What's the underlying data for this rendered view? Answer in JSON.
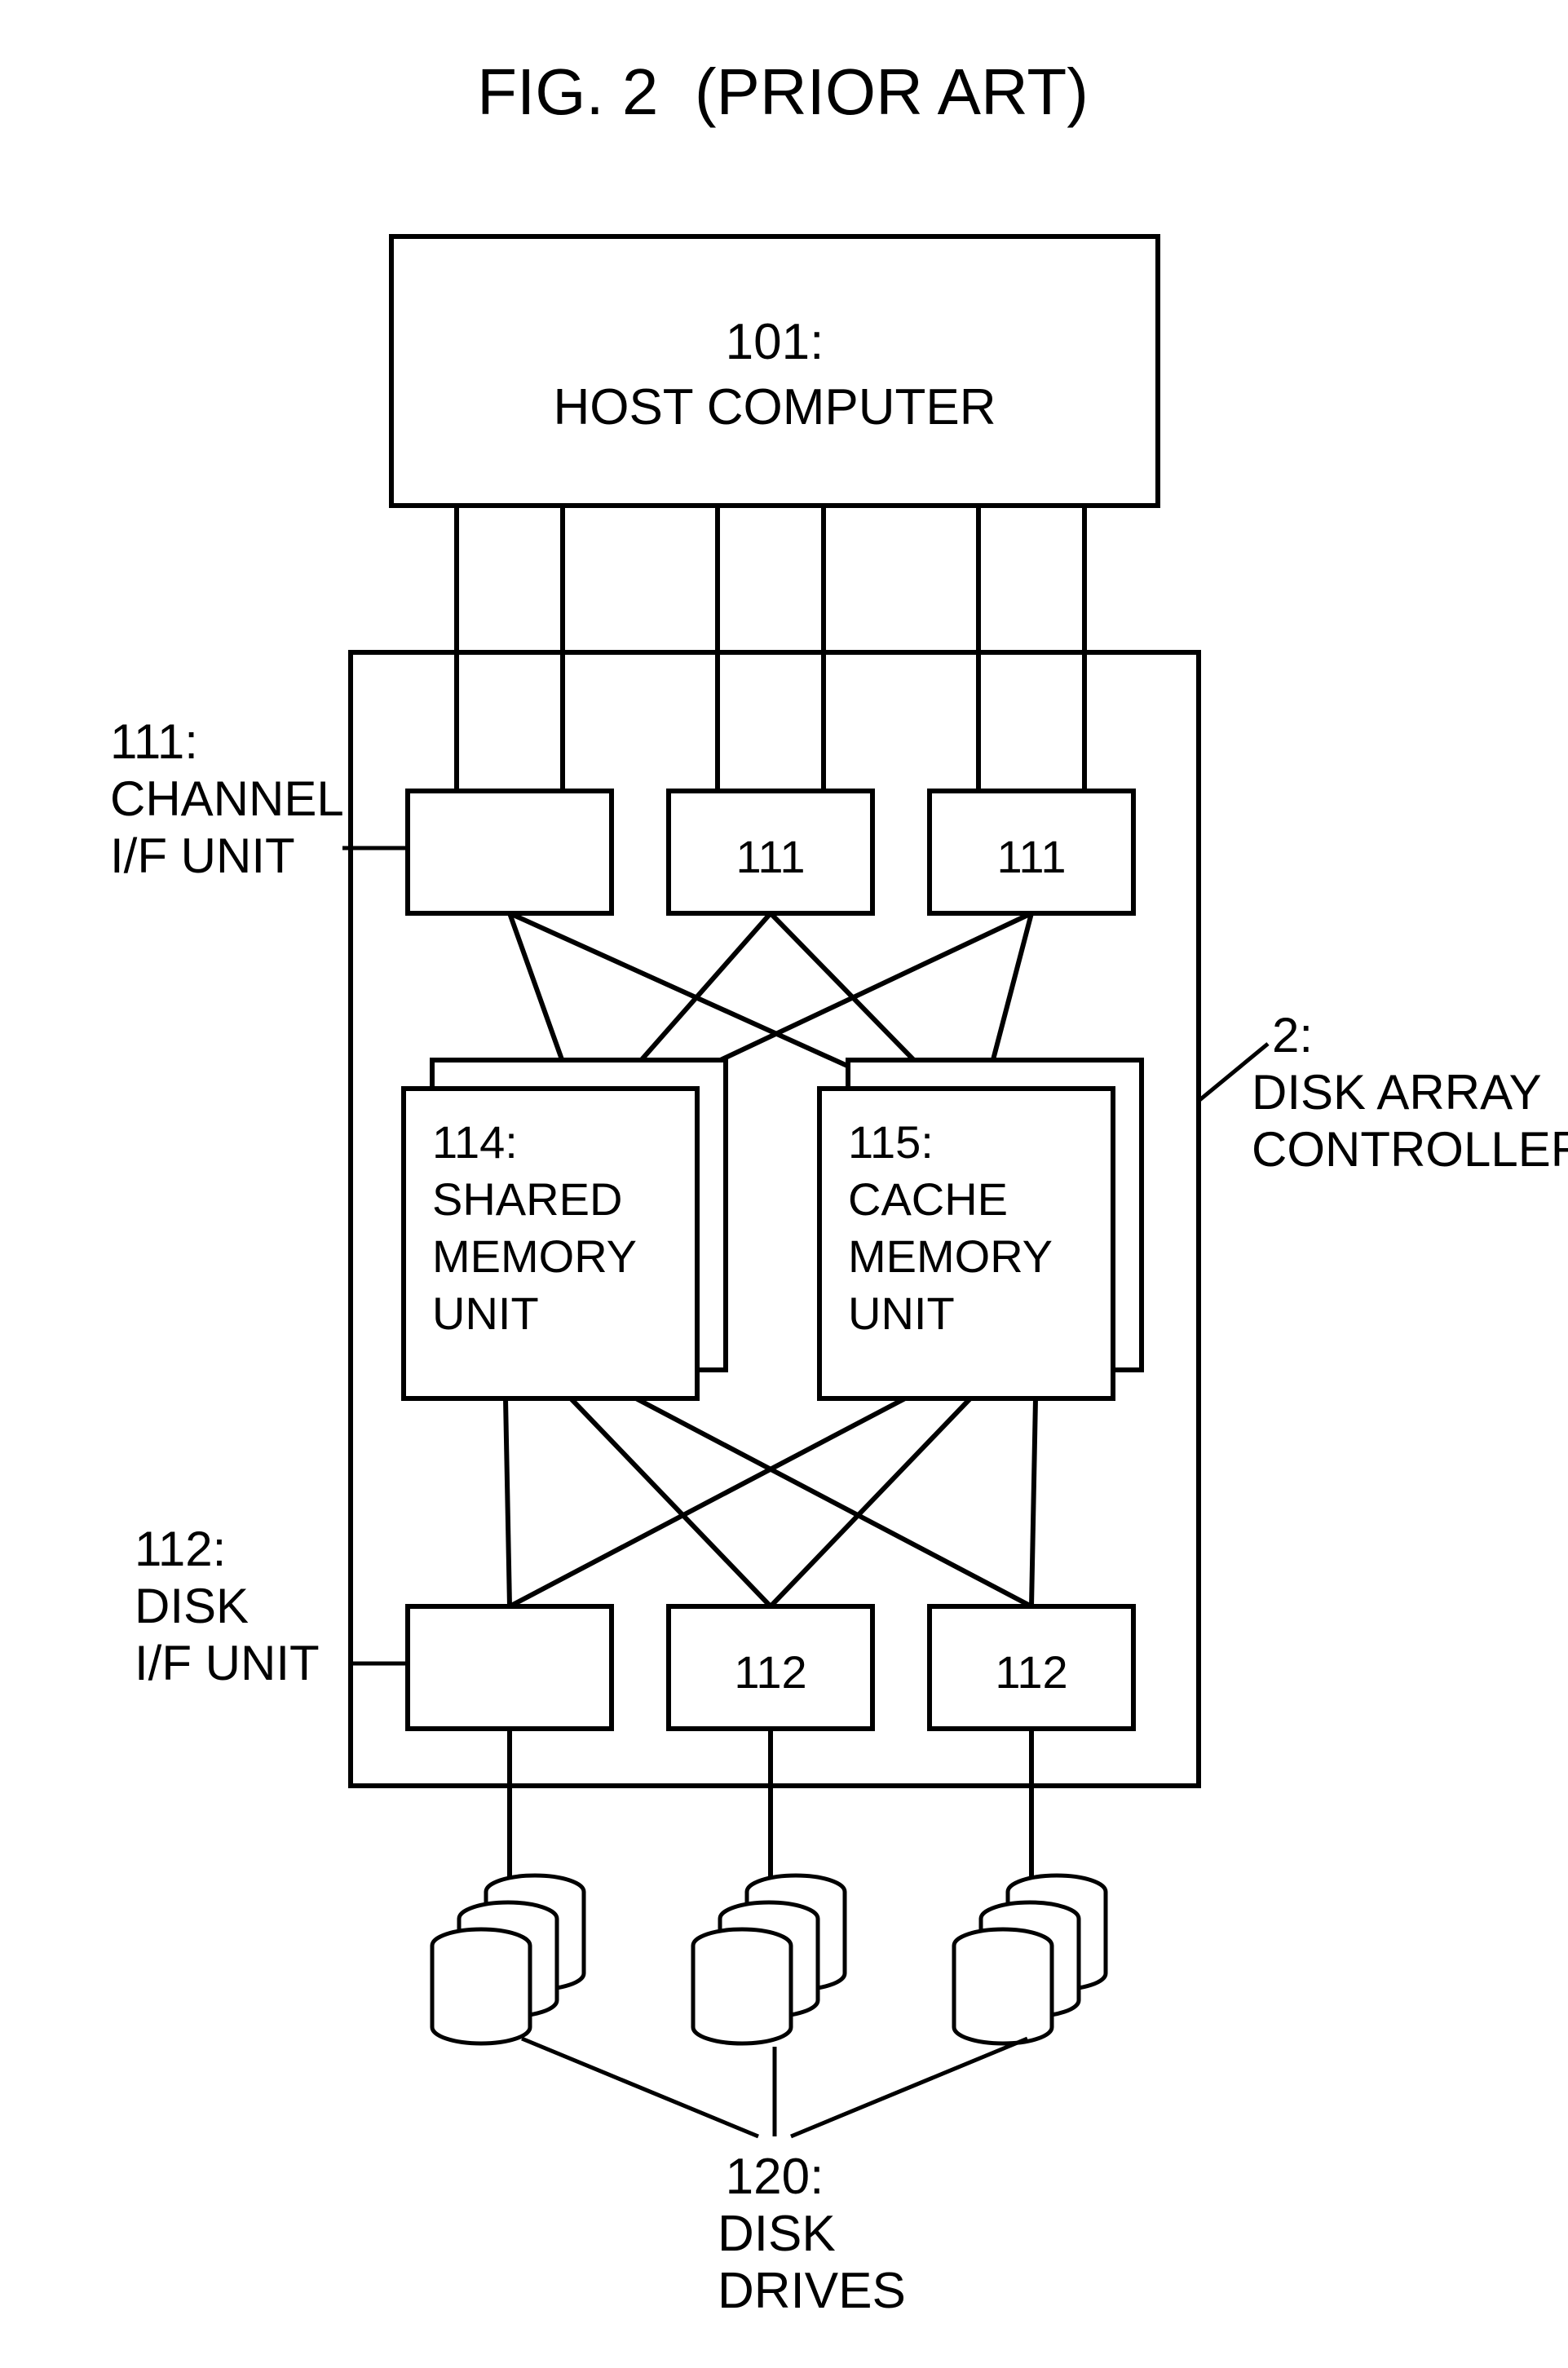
{
  "figure_title": "FIG. 2  (PRIOR ART)",
  "host": {
    "id": "101:",
    "name": "HOST COMPUTER"
  },
  "controller": {
    "id": "2:",
    "name_l1": "DISK ARRAY",
    "name_l2": "CONTROLLER"
  },
  "channel_if": {
    "id": "111:",
    "name_l1": "CHANNEL",
    "name_l2": "I/F UNIT",
    "box_label": "111"
  },
  "disk_if": {
    "id": "112:",
    "name_l1": "DISK",
    "name_l2": "I/F UNIT",
    "box_label": "112"
  },
  "shared_mem": {
    "id": "114:",
    "name_l1": "SHARED",
    "name_l2": "MEMORY",
    "name_l3": "UNIT"
  },
  "cache_mem": {
    "id": "115:",
    "name_l1": "CACHE",
    "name_l2": "MEMORY",
    "name_l3": "UNIT"
  },
  "drives": {
    "id": "120:",
    "name_l1": "DISK",
    "name_l2": "DRIVES"
  }
}
